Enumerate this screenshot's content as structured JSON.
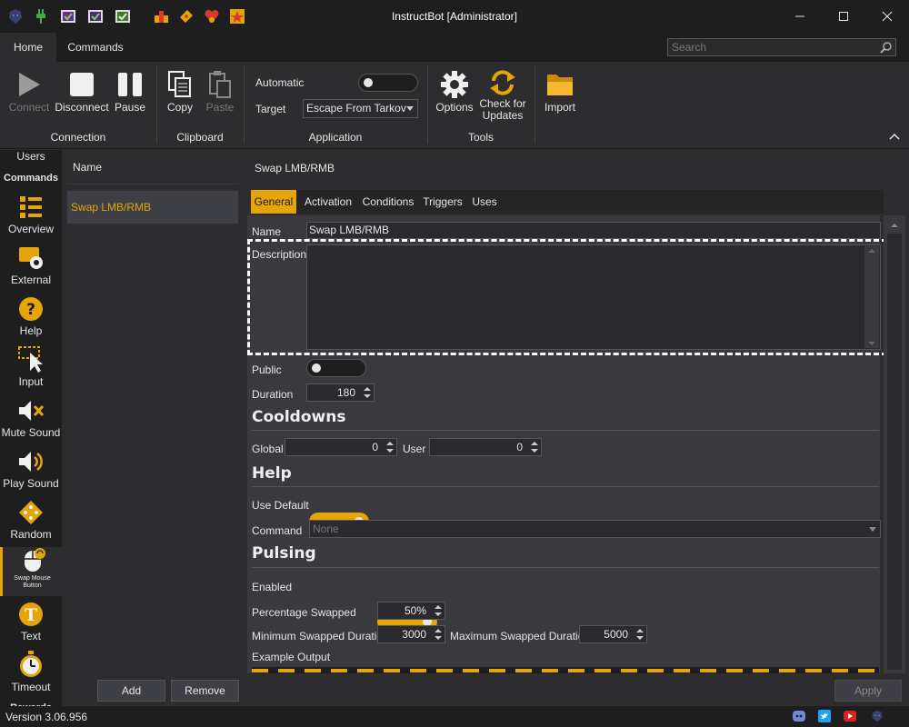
{
  "window": {
    "title": "InstructBot [Administrator]",
    "quick_access_icons": [
      "wolf-logo-icon",
      "plug-icon",
      "shield-purple-icon",
      "shield-purple-2-icon",
      "shield-green-icon",
      "pixel-people-icon",
      "ticket-icon",
      "heart-badge-icon",
      "star-badge-icon"
    ],
    "controls": [
      "minimize",
      "maximize",
      "close"
    ]
  },
  "ribbon_tabs": [
    "Home",
    "Commands"
  ],
  "search": {
    "placeholder": "Search"
  },
  "ribbon": {
    "connection": {
      "label": "Connection",
      "connect": "Connect",
      "disconnect": "Disconnect",
      "pause": "Pause"
    },
    "clipboard": {
      "label": "Clipboard",
      "copy": "Copy",
      "paste": "Paste"
    },
    "application": {
      "label": "Application",
      "automatic_label": "Automatic",
      "automatic_on": false,
      "target_label": "Target",
      "target_value": "Escape From Tarkov"
    },
    "tools": {
      "label": "Tools",
      "options": "Options",
      "check_updates_line1": "Check for",
      "check_updates_line2": "Updates"
    },
    "import": {
      "label": "Import"
    }
  },
  "nav": {
    "users": "Users",
    "commands": "Commands",
    "items": [
      {
        "label": "Overview",
        "icon": "overview-list-icon"
      },
      {
        "label": "External",
        "icon": "external-gear-icon"
      },
      {
        "label": "Help",
        "icon": "help-question-icon"
      },
      {
        "label": "Input",
        "icon": "input-cursor-icon"
      },
      {
        "label": "Mute Sound",
        "icon": "mute-speaker-icon"
      },
      {
        "label": "Play Sound",
        "icon": "speaker-icon"
      },
      {
        "label": "Random",
        "icon": "dice-icon"
      },
      {
        "label": "Swap Mouse Button",
        "icon": "mouse-swap-icon",
        "selected": true
      },
      {
        "label": "Text",
        "icon": "text-t-icon"
      },
      {
        "label": "Timeout",
        "icon": "stopwatch-icon"
      }
    ],
    "partial_next": "Rewards"
  },
  "list": {
    "header": "Name",
    "items": [
      "Swap LMB/RMB"
    ],
    "add": "Add",
    "remove": "Remove"
  },
  "detail": {
    "title": "Swap LMB/RMB",
    "tabs": [
      "General",
      "Activation",
      "Conditions",
      "Triggers",
      "Uses"
    ],
    "name_label": "Name",
    "name_value": "Swap LMB/RMB",
    "description_label": "Description",
    "description_value": "",
    "public_label": "Public",
    "public_on": false,
    "duration_label": "Duration",
    "duration_value": "180",
    "cooldowns_title": "Cooldowns",
    "global_label": "Global",
    "global_value": "0",
    "user_label": "User",
    "user_value": "0",
    "help_title": "Help",
    "use_default_label": "Use Default",
    "use_default_on": true,
    "command_label": "Command",
    "command_value": "None",
    "pulsing_title": "Pulsing",
    "enabled_label": "Enabled",
    "enabled_on": true,
    "percentage_label": "Percentage Swapped",
    "percentage_value": "50%",
    "min_label": "Minimum Swapped Duration",
    "min_value": "3000",
    "max_label": "Maximum Swapped Duration",
    "max_value": "5000",
    "example_label": "Example Output",
    "apply": "Apply"
  },
  "status": {
    "version": "Version 3.06.956",
    "social_icons": [
      "discord-icon",
      "twitter-icon",
      "youtube-icon",
      "wolf-logo-icon"
    ]
  },
  "colors": {
    "accent": "#e5a50a",
    "background": "#2d2d30",
    "dark": "#1e1e1e"
  }
}
